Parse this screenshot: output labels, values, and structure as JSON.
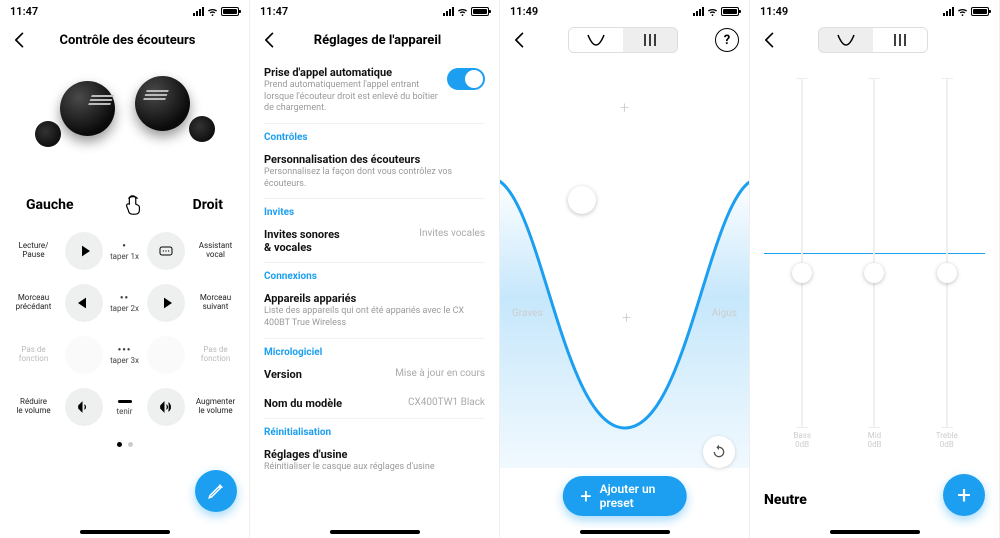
{
  "status": {
    "time1": "11:47",
    "time2": "11:47",
    "time3": "11:49",
    "time4": "11:49"
  },
  "screen1": {
    "title": "Contrôle des écouteurs",
    "sides": {
      "left": "Gauche",
      "right": "Droit"
    },
    "taps": {
      "t1": "taper 1x",
      "t2": "taper 2x",
      "t3": "taper 3x",
      "hold": "tenir"
    },
    "actions": {
      "l1": "Lecture/\nPause",
      "r1": "Assistant\nvocal",
      "l2": "Morceau\nprécédant",
      "r2": "Morceau\nsuivant",
      "l3": "Pas de\nfonction",
      "r3": "Pas de\nfonction",
      "l4": "Réduire\nle volume",
      "r4": "Augmenter\nle volume"
    }
  },
  "screen2": {
    "title": "Réglages de l'appareil",
    "auto": {
      "title": "Prise d'appel automatique",
      "sub": "Prend automatiquement l'appel entrant lorsque l'écouteur droit est enlevé du boîtier de chargement."
    },
    "sections": {
      "controls": "Contrôles",
      "custom_title": "Personnalisation des écouteurs",
      "custom_sub": "Personnalisez la façon dont vous contrôlez vos écouteurs.",
      "invites": "Invites",
      "invites_title": "Invites sonores\n& vocales",
      "invites_value": "Invites vocales",
      "conn": "Connexions",
      "paired_title": "Appareils appariés",
      "paired_sub": "Liste des appareils qui ont été appariés avec le CX 400BT True Wireless",
      "fw": "Micrologiciel",
      "version_label": "Version",
      "version_value": "Mise à jour en cours",
      "model_label": "Nom du modèle",
      "model_value": "CX400TW1 Black",
      "reset": "Réinitialisation",
      "factory_title": "Réglages d'usine",
      "factory_sub": "Réinitialiser le casque aux réglages d'usine"
    }
  },
  "screen3": {
    "labels": {
      "bass": "Graves",
      "treble": "Aigus"
    },
    "button": "Ajouter un preset"
  },
  "screen4": {
    "bands": {
      "bass": "Bass",
      "bass_db": "0dB",
      "mid": "Mid",
      "mid_db": "0dB",
      "treble": "Treble",
      "treble_db": "0dB"
    },
    "preset": "Neutre"
  },
  "colors": {
    "accent": "#1c9ff0"
  }
}
